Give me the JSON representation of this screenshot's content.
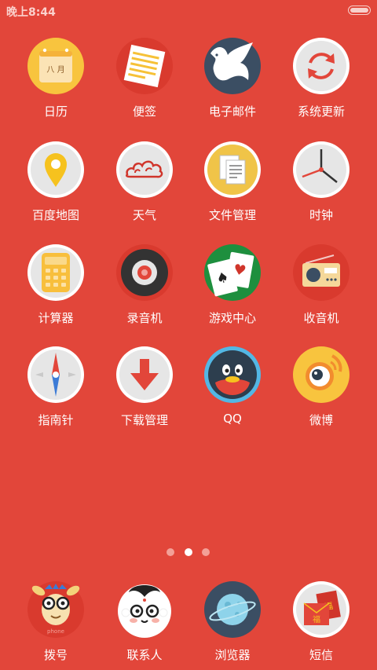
{
  "status_bar": {
    "time": "晚上8:44"
  },
  "apps": [
    {
      "label": "日历",
      "icon": "calendar-icon",
      "month_text": "八 月"
    },
    {
      "label": "便签",
      "icon": "notes-icon"
    },
    {
      "label": "电子邮件",
      "icon": "email-dove-icon"
    },
    {
      "label": "系统更新",
      "icon": "system-update-icon"
    },
    {
      "label": "百度地图",
      "icon": "map-pin-icon"
    },
    {
      "label": "天气",
      "icon": "weather-cloud-icon"
    },
    {
      "label": "文件管理",
      "icon": "file-manager-icon"
    },
    {
      "label": "时钟",
      "icon": "clock-icon"
    },
    {
      "label": "计算器",
      "icon": "calculator-icon"
    },
    {
      "label": "录音机",
      "icon": "recorder-icon"
    },
    {
      "label": "游戏中心",
      "icon": "playing-cards-icon"
    },
    {
      "label": "收音机",
      "icon": "radio-icon"
    },
    {
      "label": "指南针",
      "icon": "compass-icon"
    },
    {
      "label": "下载管理",
      "icon": "download-arrow-icon"
    },
    {
      "label": "QQ",
      "icon": "qq-penguin-icon"
    },
    {
      "label": "微博",
      "icon": "weibo-eye-icon"
    }
  ],
  "pager": {
    "count": 3,
    "active_index": 1
  },
  "dock": [
    {
      "label": "拨号",
      "icon": "dialer-goat-icon",
      "sub_text": "phone"
    },
    {
      "label": "联系人",
      "icon": "contacts-face-icon"
    },
    {
      "label": "浏览器",
      "icon": "browser-planet-icon"
    },
    {
      "label": "短信",
      "icon": "sms-envelope-icon",
      "sub_text": "福"
    }
  ],
  "colors": {
    "background": "#E2463A",
    "label": "#FFFFFF"
  }
}
